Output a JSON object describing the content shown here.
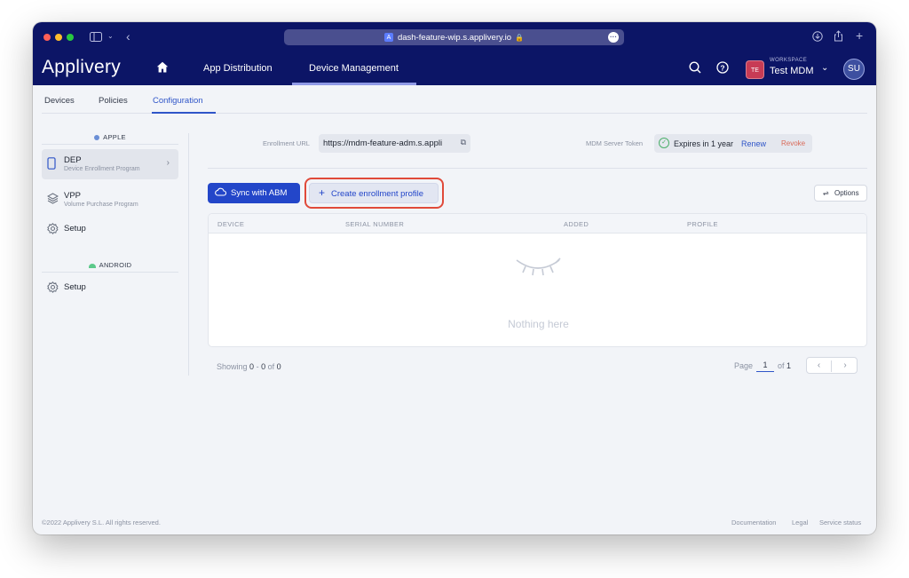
{
  "browser": {
    "url": "dash-feature-wip.s.applivery.io",
    "traffic_lights": {
      "close": "#fe5f57",
      "minimize": "#febc2e",
      "zoom": "#28c840"
    }
  },
  "header": {
    "brand": "Applivery",
    "nav": [
      {
        "label": "App Distribution",
        "active": false
      },
      {
        "label": "Device Management",
        "active": true
      }
    ],
    "workspace": {
      "label": "WORKSPACE",
      "name": "Test MDM",
      "badge": "TE"
    },
    "avatar": "SU"
  },
  "subtabs": [
    {
      "label": "Devices",
      "active": false
    },
    {
      "label": "Policies",
      "active": false
    },
    {
      "label": "Configuration",
      "active": true
    }
  ],
  "sidebar": {
    "apple_section": "APPLE",
    "apple_items": [
      {
        "title": "DEP",
        "subtitle": "Device Enrollment Program",
        "active": true
      },
      {
        "title": "VPP",
        "subtitle": "Volume Purchase Program",
        "active": false
      },
      {
        "title": "Setup",
        "subtitle": "",
        "active": false
      }
    ],
    "android_section": "ANDROID",
    "android_items": [
      {
        "title": "Setup"
      }
    ]
  },
  "config": {
    "enrollment_url_label": "Enrollment URL",
    "enrollment_url": "https://mdm-feature-adm.s.appli",
    "mdm_token_label": "MDM Server Token",
    "token_status": "Expires in 1 year",
    "renew_label": "Renew",
    "revoke_label": "Revoke"
  },
  "actions": {
    "sync_label": "Sync with ABM",
    "create_label": "Create enrollment profile",
    "options_label": "Options",
    "highlight_color": "#e04a3a"
  },
  "table": {
    "columns": [
      "DEVICE",
      "SERIAL NUMBER",
      "ADDED",
      "PROFILE"
    ],
    "empty_text": "Nothing here"
  },
  "pagination": {
    "showing_prefix": "Showing",
    "from": "0",
    "to": "0",
    "of_label": "of",
    "total": "0",
    "page_label": "Page",
    "page": "1",
    "page_of_label": "of",
    "page_total": "1"
  },
  "footer": {
    "copyright": "©2022 Applivery S.L. All rights reserved.",
    "links": [
      "Documentation",
      "Legal",
      "Service status"
    ]
  },
  "colors": {
    "brand_navy": "#0c1566",
    "primary_blue": "#2346c9",
    "accent_link": "#2f55c8"
  }
}
